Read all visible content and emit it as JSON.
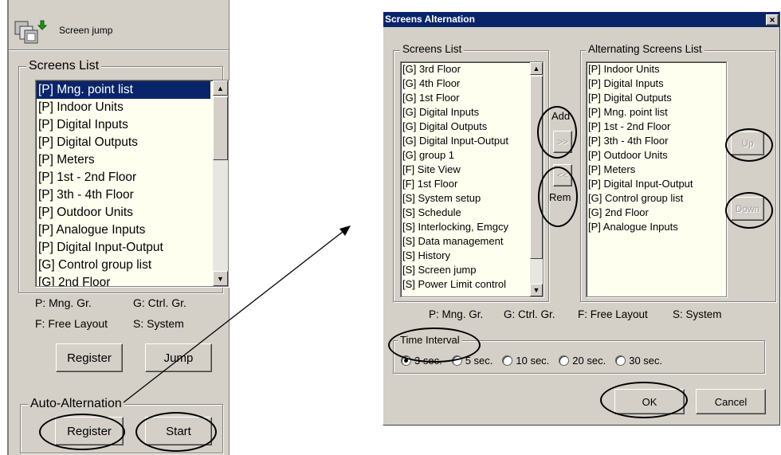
{
  "left_panel": {
    "title": "Screen jump",
    "screens_list_label": "Screens List",
    "items": [
      "[P] Mng. point list",
      "[P] Indoor Units",
      "[P] Digital Inputs",
      "[P] Digital Outputs",
      "[P] Meters",
      "[P] 1st - 2nd Floor",
      "[P] 3th - 4th Floor",
      "[P] Outdoor Units",
      "[P] Analogue Inputs",
      "[P] Digital Input-Output",
      "[G] Control group list",
      "[G] 2nd Floor"
    ],
    "selected_index": 0,
    "legend_mng": "P: Mng. Gr.",
    "legend_ctrl": "G: Ctrl. Gr.",
    "legend_free": "F: Free Layout",
    "legend_system": "S: System",
    "register_label": "Register",
    "jump_label": "Jump",
    "auto_alt_label": "Auto-Alternation",
    "auto_register_label": "Register",
    "start_label": "Start"
  },
  "dialog": {
    "title": "Screens Alternation",
    "close_glyph": "×",
    "screens_list_label": "Screens List",
    "screens": [
      "[G] 3rd Floor",
      "[G] 4th Floor",
      "[G] 1st Floor",
      "[G] Digital Inputs",
      "[G] Digital Outputs",
      "[G] Digital Input-Output",
      "[G] group 1",
      "[F] Site View",
      "[F] 1st Floor",
      "[S] System setup",
      "[S] Schedule",
      "[S] Interlocking, Emgcy",
      "[S] Data management",
      "[S] History",
      "[S] Screen jump",
      "[S] Power Limit control"
    ],
    "alternating_label": "Alternating Screens List",
    "alternating": [
      "[P] Indoor Units",
      "[P] Digital Inputs",
      "[P] Digital Outputs",
      "[P] Mng. point list",
      "[P] 1st - 2nd Floor",
      "[P] 3th - 4th Floor",
      "[P] Outdoor Units",
      "[P] Meters",
      "[P] Digital Input-Output",
      "[G] Control group list",
      "[G] 2nd Floor",
      "[P] Analogue Inputs"
    ],
    "add_label": "Add",
    "add_glyph": ">>",
    "rem_label": "Rem",
    "rem_glyph": "<<",
    "up_label": "Up",
    "down_label": "Down",
    "legend_mng": "P: Mng. Gr.",
    "legend_ctrl": "G: Ctrl. Gr.",
    "legend_free": "F: Free Layout",
    "legend_system": "S: System",
    "time_interval_label": "Time Interval",
    "intervals": [
      "3 sec.",
      "5 sec.",
      "10 sec.",
      "20 sec.",
      "30 sec."
    ],
    "selected_interval": 0,
    "ok_label": "OK",
    "cancel_label": "Cancel"
  },
  "colors": {
    "window_bg": "#d4d0c8",
    "title_bar": "#0a246a",
    "list_bg": "#fffff0",
    "selection": "#0a246a"
  }
}
